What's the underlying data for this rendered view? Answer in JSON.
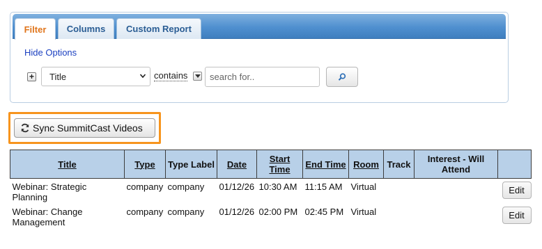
{
  "tabs": [
    {
      "label": "Filter",
      "active": true
    },
    {
      "label": "Columns",
      "active": false
    },
    {
      "label": "Custom Report",
      "active": false
    }
  ],
  "filter": {
    "hide_options_label": "Hide Options",
    "add_symbol": "+",
    "field_value": "Title",
    "operator_label": "contains",
    "search_placeholder": "search for.."
  },
  "sync": {
    "label": "Sync SummitCast Videos",
    "highlight_color": "#f7941d"
  },
  "table": {
    "columns": [
      {
        "label": "Title",
        "sortable": true
      },
      {
        "label": "Type",
        "sortable": true
      },
      {
        "label": "Type Label",
        "sortable": false
      },
      {
        "label": "Date",
        "sortable": true
      },
      {
        "label": "Start Time",
        "sortable": true
      },
      {
        "label": "End Time",
        "sortable": true
      },
      {
        "label": "Room",
        "sortable": true
      },
      {
        "label": "Track",
        "sortable": false
      },
      {
        "label": "Interest - Will Attend",
        "sortable": false
      },
      {
        "label": "",
        "sortable": false
      }
    ],
    "rows": [
      {
        "title": "Webinar: Strategic Planning",
        "type": "company",
        "type_label": "company",
        "date": "01/12/26",
        "start": "10:30 AM",
        "end": "11:15 AM",
        "room": "Virtual",
        "track": "",
        "interest": "",
        "action": "Edit"
      },
      {
        "title": "Webinar: Change Management",
        "type": "company",
        "type_label": "company",
        "date": "01/12/26",
        "start": "02:00 PM",
        "end": "02:45 PM",
        "room": "Virtual",
        "track": "",
        "interest": "",
        "action": "Edit"
      }
    ]
  },
  "colors": {
    "tab_bar": "#4f8fcf",
    "active_tab_text": "#e0751b",
    "link": "#1a3fc0",
    "table_header": "#b8d0e8"
  }
}
